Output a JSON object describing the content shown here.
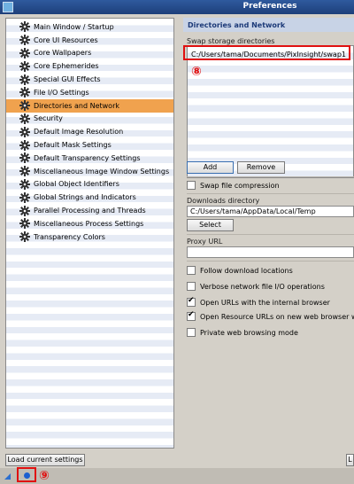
{
  "window": {
    "title": "Preferences"
  },
  "categories": [
    {
      "label": "Main Window / Startup",
      "selected": false
    },
    {
      "label": "Core UI Resources",
      "selected": false
    },
    {
      "label": "Core Wallpapers",
      "selected": false
    },
    {
      "label": "Core Ephemerides",
      "selected": false
    },
    {
      "label": "Special GUI Effects",
      "selected": false
    },
    {
      "label": "File I/O Settings",
      "selected": false
    },
    {
      "label": "Directories and Network",
      "selected": true
    },
    {
      "label": "Security",
      "selected": false
    },
    {
      "label": "Default Image Resolution",
      "selected": false
    },
    {
      "label": "Default Mask Settings",
      "selected": false
    },
    {
      "label": "Default Transparency Settings",
      "selected": false
    },
    {
      "label": "Miscellaneous Image Window Settings",
      "selected": false
    },
    {
      "label": "Global Object Identifiers",
      "selected": false
    },
    {
      "label": "Global Strings and Indicators",
      "selected": false
    },
    {
      "label": "Parallel Processing and Threads",
      "selected": false
    },
    {
      "label": "Miscellaneous Process Settings",
      "selected": false
    },
    {
      "label": "Transparency Colors",
      "selected": false
    }
  ],
  "panel": {
    "title": "Directories and Network",
    "swap_label": "Swap storage directories",
    "swap_dirs": [
      "C:/Users/tama/Documents/PixInsight/swap1"
    ],
    "marker_8": "⑧",
    "add_label": "Add",
    "remove_label": "Remove",
    "swap_compression_label": "Swap file compression",
    "swap_compression": false,
    "downloads_label": "Downloads directory",
    "downloads_value": "C:/Users/tama/AppData/Local/Temp",
    "select_label": "Select",
    "proxy_label": "Proxy URL",
    "proxy_value": "",
    "options": [
      {
        "label": "Follow download locations",
        "checked": false
      },
      {
        "label": "Verbose network file I/O operations",
        "checked": false
      },
      {
        "label": "Open URLs with the internal browser",
        "checked": true
      },
      {
        "label": "Open Resource URLs on new web browser win",
        "checked": true
      },
      {
        "label": "Private web browsing mode",
        "checked": false
      }
    ]
  },
  "footer": {
    "load_label": "Load current settings",
    "right_btn_label": "L",
    "marker_9": "⑨"
  },
  "colors": {
    "selected": "#f0a24e",
    "header_bg": "#c8d3e6",
    "header_text": "#1c3a78",
    "annotation": "#e01010"
  }
}
